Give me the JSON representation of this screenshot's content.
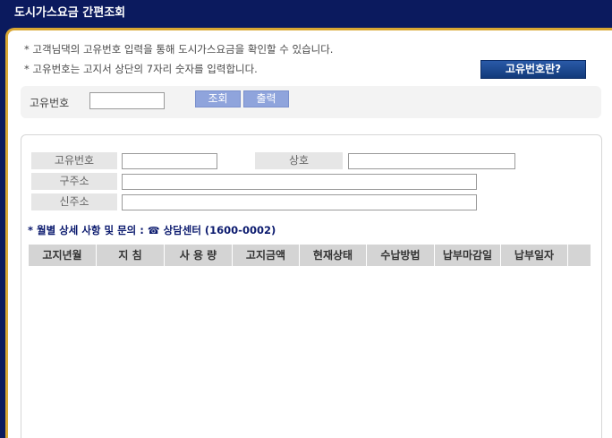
{
  "window": {
    "title": "도시가스요금 간편조회"
  },
  "notices": [
    "* 고객님댁의 고유번호 입력을 통해 도시가스요금을 확인할 수 있습니다.",
    "* 고유번호는 고지서 상단의 7자리 숫자를 입력합니다."
  ],
  "about_button": "고유번호란?",
  "search": {
    "label": "고유번호",
    "value": "",
    "search_button": "조회",
    "print_button": "출력"
  },
  "info": {
    "id_label": "고유번호",
    "name_label": "상호",
    "old_address_label": "구주소",
    "new_address_label": "신주소"
  },
  "inquiry": {
    "text": "* 월별 상세 사항 및 문의 :",
    "phone_icon": "phone-icon",
    "phone_glyph": "☎",
    "center": "상담센터 (1600-0002)"
  },
  "table": {
    "columns": [
      "고지년월",
      "지 침",
      "사 용 량",
      "고지금액",
      "현재상태",
      "수납방법",
      "납부마감일",
      "납부일자"
    ],
    "rows": []
  },
  "colors": {
    "title_bar": "#0b1a5e",
    "frame_border": "#d9a733",
    "small_button": "#8fa4dc",
    "about_button": "#1f4a94",
    "inquiry_text": "#0b1a6e"
  }
}
